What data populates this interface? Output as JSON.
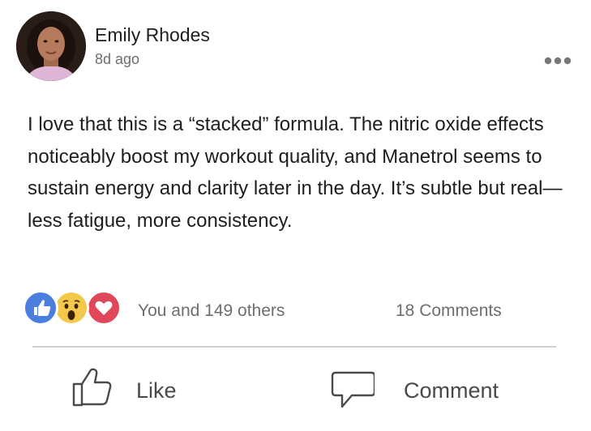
{
  "post": {
    "author": {
      "name": "Emily Rhodes",
      "avatar_icon": "profile-photo"
    },
    "timestamp": "8d ago",
    "more_icon": "ellipsis-icon",
    "text": "I love that this is a “stacked” formula. The nitric oxide effects noticeably boost my workout quality, and Manetrol seems to sustain energy and clarity later in the day. It’s subtle but real—less fatigue, more consistency.",
    "reactions": {
      "icons": [
        "like-icon",
        "wow-icon",
        "love-icon"
      ],
      "summary": "You and 149 others",
      "comments": "18 Comments"
    },
    "actions": {
      "like": {
        "label": "Like",
        "icon": "thumbs-up-icon"
      },
      "comment": {
        "label": "Comment",
        "icon": "speech-bubble-icon"
      }
    }
  },
  "colors": {
    "like_blue": "#4a7fe0",
    "wow_yellow": "#f4c84b",
    "love_red": "#e0485a",
    "text": "#1c1e21",
    "muted": "#6e6e6e",
    "divider": "#d0d0d0"
  }
}
